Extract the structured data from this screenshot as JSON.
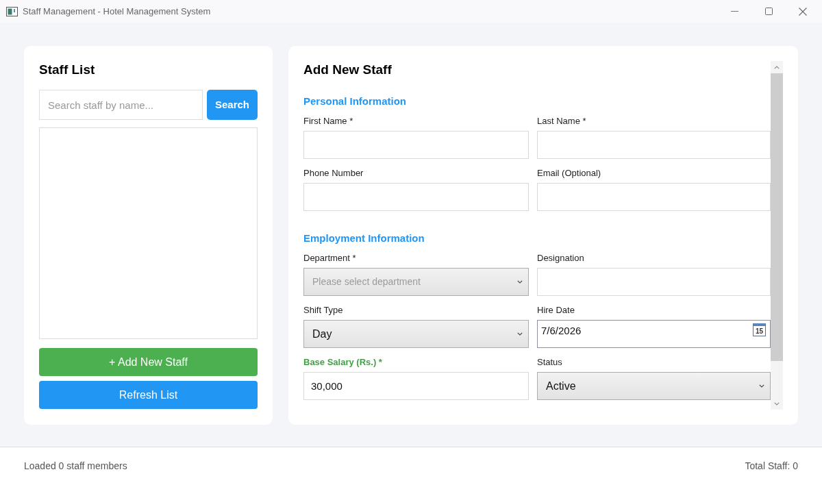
{
  "window": {
    "title": "Staff Management - Hotel Management System"
  },
  "staff_list": {
    "title": "Staff List",
    "search": {
      "placeholder": "Search staff by name...",
      "button": "Search"
    },
    "actions": [
      {
        "label": "+ Add New Staff",
        "kind": "add"
      },
      {
        "label": "Refresh List",
        "kind": "refresh"
      }
    ]
  },
  "form": {
    "title": "Add New Staff",
    "sections": [
      {
        "title": "Personal Information",
        "fields": [
          {
            "label": "First Name *",
            "kind": "text",
            "highlighted": false
          },
          {
            "label": "Last Name *",
            "kind": "text",
            "highlighted": false
          },
          {
            "label": "Phone Number",
            "kind": "text",
            "highlighted": false
          },
          {
            "label": "Email (Optional)",
            "kind": "text",
            "highlighted": false
          }
        ]
      },
      {
        "title": "Employment Information",
        "fields": [
          {
            "label": "Department *",
            "kind": "select",
            "placeholder": "Please select department",
            "highlighted": false
          },
          {
            "label": "Designation",
            "kind": "text",
            "highlighted": false
          },
          {
            "label": "Shift Type",
            "kind": "select",
            "value": "Day",
            "highlighted": false
          },
          {
            "label": "Hire Date",
            "kind": "date",
            "value": "7/6/2026",
            "calendar_day": "15",
            "highlighted": false
          },
          {
            "label": "Base Salary (Rs.) *",
            "kind": "text",
            "value": "30,000",
            "highlighted": true
          },
          {
            "label": "Status",
            "kind": "select",
            "value": "Active",
            "highlighted": false
          }
        ]
      }
    ]
  },
  "status_bar": {
    "message": "Loaded 0 staff members",
    "total": "Total Staff: 0"
  }
}
